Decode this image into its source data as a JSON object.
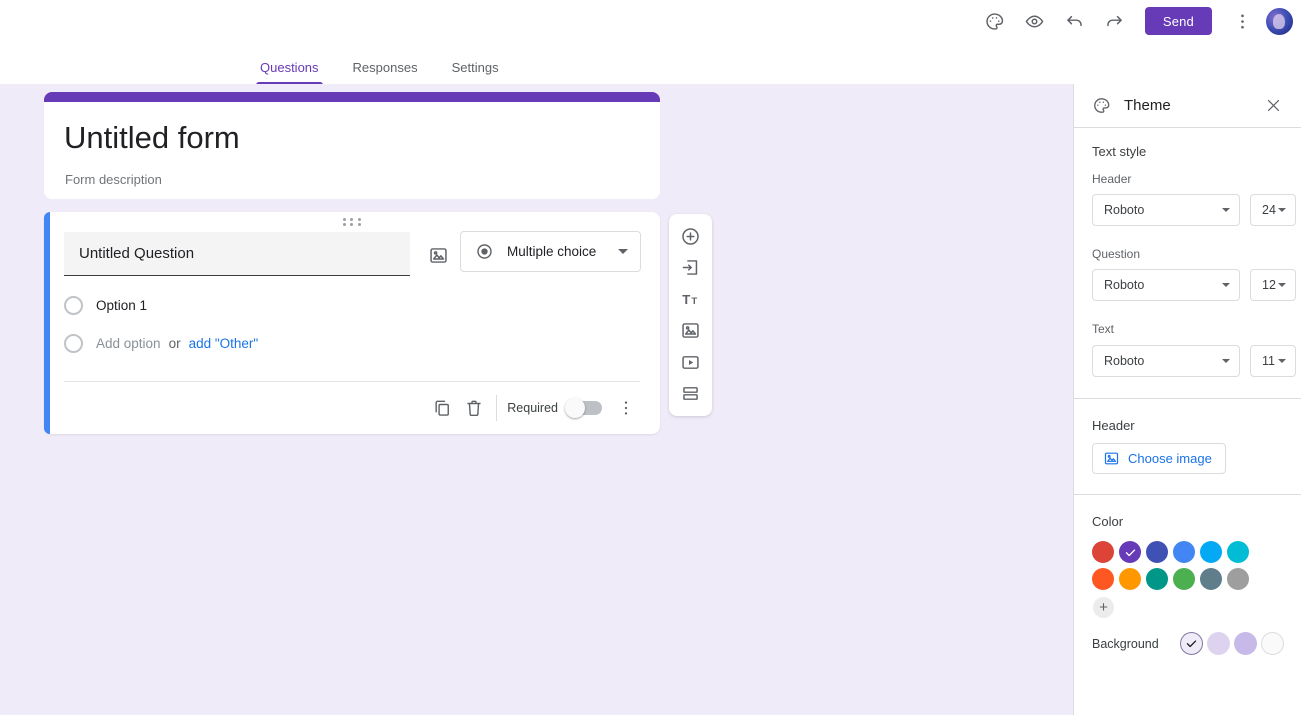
{
  "topbar": {
    "send_button": "Send"
  },
  "tabs": {
    "questions": "Questions",
    "responses": "Responses",
    "settings": "Settings"
  },
  "form_card": {
    "title": "Untitled form",
    "description": "Form description"
  },
  "question_card": {
    "title": "Untitled Question",
    "type_selector": "Multiple choice",
    "option1": "Option 1",
    "add_option": "Add option",
    "or_text": "or",
    "add_other": "add \"Other\"",
    "required_label": "Required"
  },
  "theme_panel": {
    "title": "Theme",
    "text_style_label": "Text style",
    "header_label": "Header",
    "header_font": "Roboto",
    "header_size": "24",
    "question_label": "Question",
    "question_font": "Roboto",
    "question_size": "12",
    "text_label": "Text",
    "text_font": "Roboto",
    "text_size": "11",
    "header_image_label": "Header",
    "choose_image_button": "Choose image",
    "color_label": "Color",
    "color_swatches": [
      {
        "hex": "#db4437",
        "selected": false
      },
      {
        "hex": "#673ab7",
        "selected": true,
        "check": "#ffffff"
      },
      {
        "hex": "#3f51b5",
        "selected": false
      },
      {
        "hex": "#4285f4",
        "selected": false
      },
      {
        "hex": "#03a9f4",
        "selected": false
      },
      {
        "hex": "#00bcd4",
        "selected": false
      },
      {
        "hex": "#ff5722",
        "selected": false
      },
      {
        "hex": "#ff9800",
        "selected": false
      },
      {
        "hex": "#009688",
        "selected": false
      },
      {
        "hex": "#4caf50",
        "selected": false
      },
      {
        "hex": "#607d8b",
        "selected": false
      },
      {
        "hex": "#9e9e9e",
        "selected": false
      }
    ],
    "background_label": "Background",
    "background_swatches": [
      {
        "hex": "#f0ebf8",
        "selected": true,
        "border": "#84789e",
        "check": "#202124"
      },
      {
        "hex": "#ddd3ee",
        "selected": false
      },
      {
        "hex": "#c7b9e8",
        "selected": false
      },
      {
        "hex": "#fafafa",
        "selected": false,
        "border": "#dadce0"
      }
    ]
  },
  "colors": {
    "accent_purple": "#673ab7",
    "page_background": "#f0ebf8",
    "selected_question_bar": "#4285f4",
    "link_blue": "#1a73e8"
  }
}
